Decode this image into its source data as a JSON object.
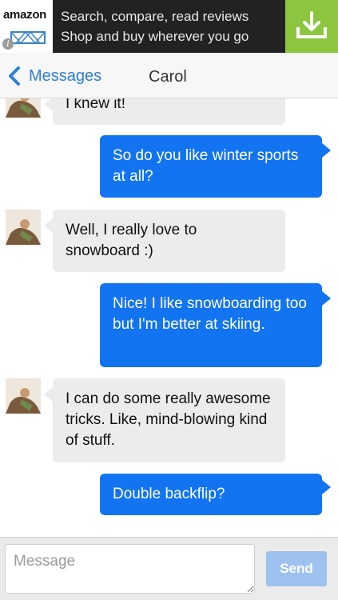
{
  "ad": {
    "brand": "amazon",
    "info_glyph": "i",
    "line1": "Search, compare, read reviews",
    "line2": "Shop and buy wherever you go",
    "download_icon": "download-icon",
    "accent_color": "#8cc63f"
  },
  "nav": {
    "back_label": "Messages",
    "title": "Carol"
  },
  "messages": [
    {
      "direction": "incoming",
      "text": "I knew it!"
    },
    {
      "direction": "outgoing",
      "text": "So do you like winter sports at all?"
    },
    {
      "direction": "incoming",
      "text": "Well, I really love to snowboard :)"
    },
    {
      "direction": "outgoing",
      "text": "Nice! I like snowboarding too but I'm better at skiing."
    },
    {
      "direction": "incoming",
      "text": "I can do some really awesome tricks. Like, mind-blowing kind of stuff."
    },
    {
      "direction": "outgoing",
      "text": "Double backflip?"
    }
  ],
  "composer": {
    "placeholder": "Message",
    "value": "",
    "send_label": "Send"
  },
  "colors": {
    "outgoing_bubble": "#1274f1",
    "incoming_bubble": "#ececec",
    "link_blue": "#2f7fd8",
    "send_disabled": "#9ec2ef"
  }
}
